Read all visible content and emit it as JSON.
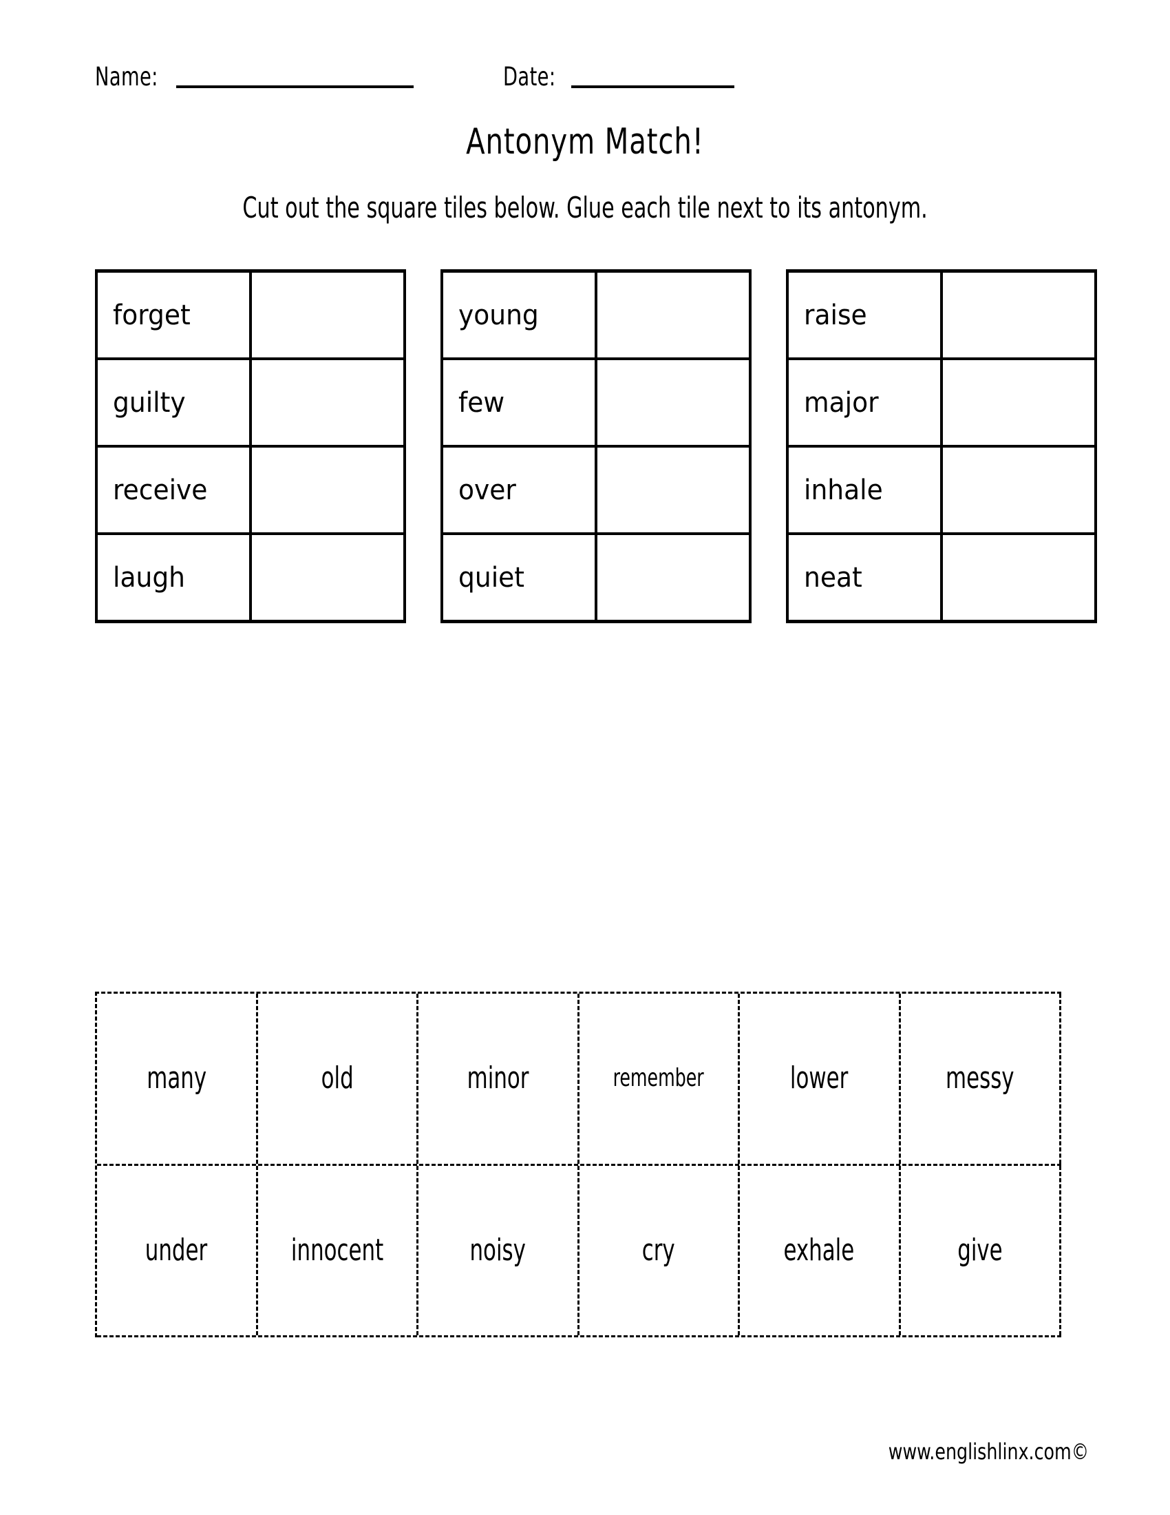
{
  "header": {
    "name_label": "Name:",
    "date_label": "Date:"
  },
  "title": "Antonym Match!",
  "instructions": "Cut out the square tiles below. Glue each tile next to its antonym.",
  "match_grids": [
    {
      "rows": [
        {
          "word": "forget",
          "answer": ""
        },
        {
          "word": "guilty",
          "answer": ""
        },
        {
          "word": "receive",
          "answer": ""
        },
        {
          "word": "laugh",
          "answer": ""
        }
      ]
    },
    {
      "rows": [
        {
          "word": "young",
          "answer": ""
        },
        {
          "word": "few",
          "answer": ""
        },
        {
          "word": "over",
          "answer": ""
        },
        {
          "word": "quiet",
          "answer": ""
        }
      ]
    },
    {
      "rows": [
        {
          "word": "raise",
          "answer": ""
        },
        {
          "word": "major",
          "answer": ""
        },
        {
          "word": "inhale",
          "answer": ""
        },
        {
          "word": "neat",
          "answer": ""
        }
      ]
    }
  ],
  "tile_bank": {
    "rows": [
      [
        "many",
        "old",
        "minor",
        "remember",
        "lower",
        "messy"
      ],
      [
        "under",
        "innocent",
        "noisy",
        "cry",
        "exhale",
        "give"
      ]
    ]
  },
  "footer": "www.englishlinx.com©",
  "colors": {
    "ink": "#000000",
    "paper": "#ffffff"
  }
}
